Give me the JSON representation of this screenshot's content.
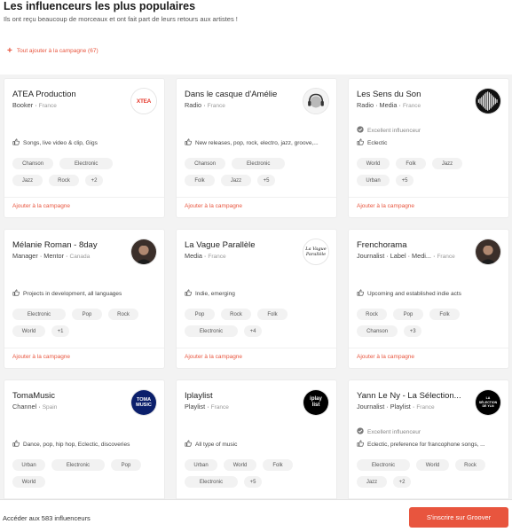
{
  "header": {
    "title": "Les influenceurs les plus populaires",
    "subtitle": "Ils ont reçu beaucoup de morceaux et ont fait part de leurs retours aux artistes !",
    "add_all": "Tout ajouter à la campagne (67)"
  },
  "add_label": "Ajouter à la campagne",
  "cards": [
    {
      "name": "ATEA Production",
      "roles": "Booker",
      "country": "France",
      "badge": "",
      "desc": "Songs, live video & clip, Gigs",
      "tags": [
        "Chanson",
        "Electronic",
        "Jazz",
        "Rock",
        "+2"
      ],
      "avatar_icon": "atea-logo-icon"
    },
    {
      "name": "Dans le casque d'Amélie",
      "roles": "Radio",
      "country": "France",
      "badge": "",
      "desc": "New releases, pop, rock, electro, jazz, groove,...",
      "tags": [
        "Chanson",
        "Electronic",
        "Folk",
        "Jazz",
        "+5"
      ],
      "avatar_icon": "headphones-logo-icon"
    },
    {
      "name": "Les Sens du Son",
      "roles": "Radio · Media",
      "country": "France",
      "badge": "Excellent influenceur",
      "desc": "Eclectic",
      "tags": [
        "World",
        "Folk",
        "Jazz",
        "Urban",
        "+5"
      ],
      "avatar_icon": "soundwave-logo-icon"
    },
    {
      "name": "Mélanie Roman - 8day",
      "roles": "Manager · Mentor",
      "country": "Canada",
      "badge": "",
      "desc": "Projects in development, all languages",
      "tags": [
        "Electronic",
        "Pop",
        "Rock",
        "World",
        "+1"
      ],
      "avatar_icon": "profile-photo-icon"
    },
    {
      "name": "La Vague Parallèle",
      "roles": "Media",
      "country": "France",
      "badge": "",
      "desc": "Indie, emerging",
      "tags": [
        "Pop",
        "Rock",
        "Folk",
        "Electronic",
        "+4"
      ],
      "avatar_icon": "handwritten-logo-icon"
    },
    {
      "name": "Frenchorama",
      "roles": "Journalist · Label · Medi...",
      "country": "France",
      "badge": "",
      "desc": "Upcoming and established indie acts",
      "tags": [
        "Rock",
        "Pop",
        "Folk",
        "Chanson",
        "+3"
      ],
      "avatar_icon": "profile-photo-icon"
    },
    {
      "name": "TomaMusic",
      "roles": "Channel",
      "country": "Spain",
      "badge": "",
      "desc": "Dance, pop, hip hop, Eclectic, discoveries",
      "tags": [
        "Urban",
        "Electronic",
        "Pop",
        "World"
      ],
      "avatar_icon": "tomamusic-logo-icon"
    },
    {
      "name": "Iplaylist",
      "roles": "Playlist",
      "country": "France",
      "badge": "",
      "desc": "All type of music",
      "tags": [
        "Urban",
        "World",
        "Folk",
        "Electronic",
        "+5"
      ],
      "avatar_icon": "iplaylist-logo-icon"
    },
    {
      "name": "Yann Le Ny - La Sélection...",
      "roles": "Journalist · Playlist",
      "country": "France",
      "badge": "Excellent influenceur",
      "desc": "Eclectic, preference for francophone songs, ...",
      "tags": [
        "Electronic",
        "World",
        "Rock",
        "Jazz",
        "+2"
      ],
      "avatar_icon": "selection-logo-icon"
    }
  ],
  "avatars": {
    "atea": "XTEA",
    "vague": "La Vague Parallèle",
    "toma": "TOMA MUSIC",
    "iplaylist": "iplay list",
    "selection": "LA SÉLECTION DE YLN"
  },
  "bottom": {
    "count_text": "Accéder aux 583 influenceurs",
    "signup": "S'inscrire sur Groover"
  },
  "colors": {
    "accent": "#e8553e",
    "tag_bg": "#f2f2f2",
    "page_bg": "#f3f3f3"
  }
}
